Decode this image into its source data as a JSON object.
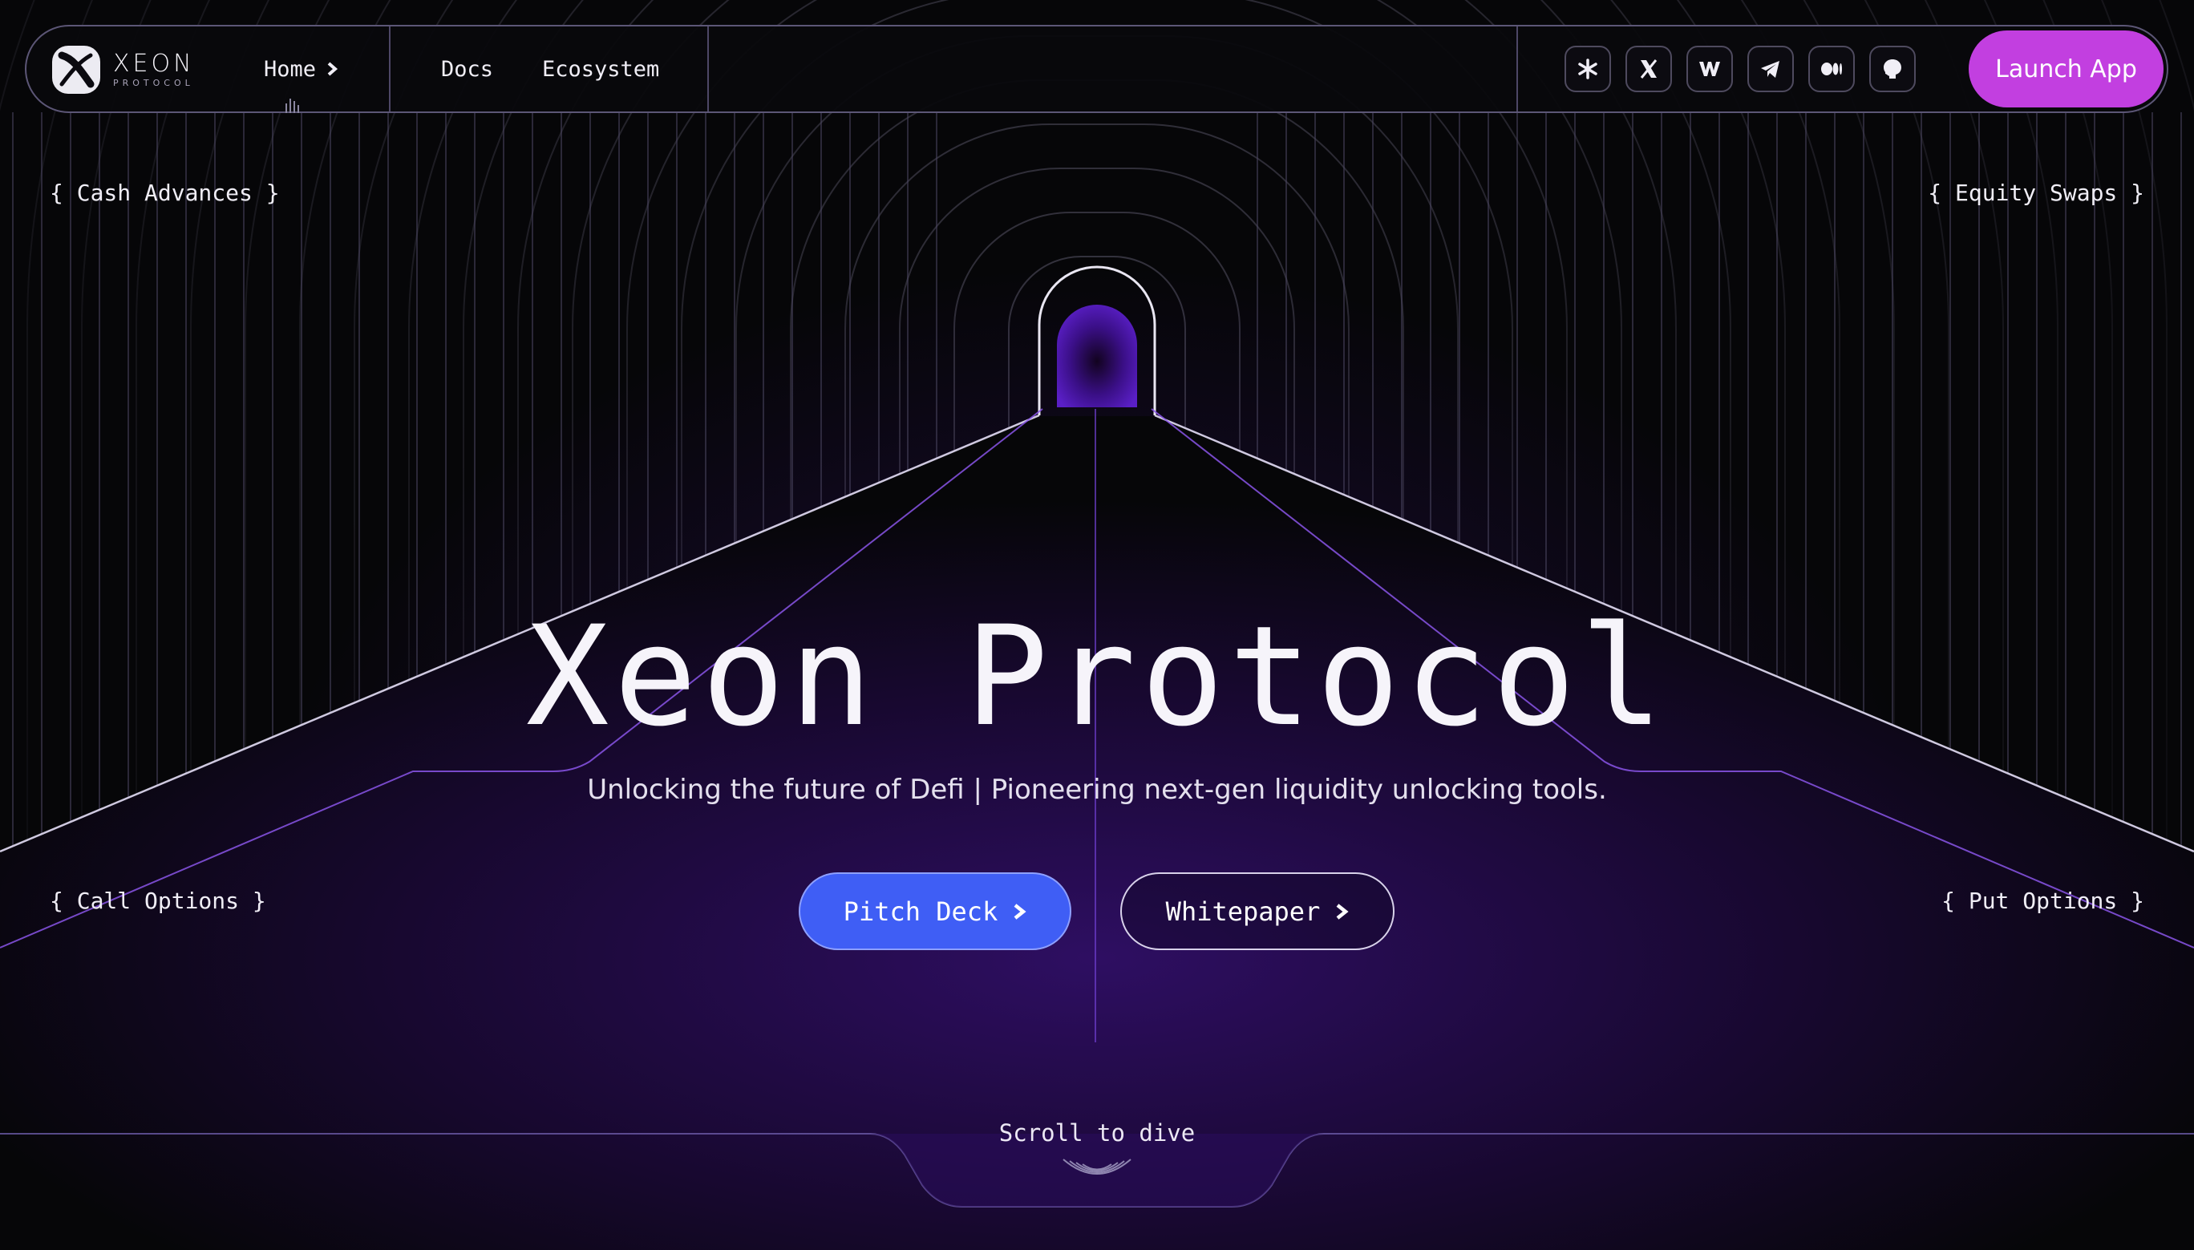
{
  "brand": {
    "name": "XEON",
    "sub": "PROTOCOL"
  },
  "nav": {
    "links": [
      {
        "label": "Home"
      },
      {
        "label": "Docs"
      },
      {
        "label": "Ecosystem"
      }
    ],
    "socials": [
      {
        "icon": "linktree-icon"
      },
      {
        "icon": "x-twitter-icon"
      },
      {
        "icon": "wellfound-icon"
      },
      {
        "icon": "telegram-icon"
      },
      {
        "icon": "medium-icon"
      },
      {
        "icon": "github-icon"
      }
    ],
    "launch_label": "Launch App"
  },
  "corners": {
    "top_left": "{ Cash Advances }",
    "top_right": "{ Equity Swaps }",
    "bottom_left": "{ Call Options }",
    "bottom_right": "{ Put Options }"
  },
  "hero": {
    "title": "Xeon Protocol",
    "subtitle": "Unlocking the future of Defi | Pioneering next-gen liquidity unlocking tools.",
    "primary_button": "Pitch Deck",
    "secondary_button": "Whitepaper"
  },
  "scroll": {
    "label": "Scroll to dive"
  },
  "colors": {
    "launch": "#c23fe0",
    "primary_button": "#3f5ef5",
    "glow": "#4e1a96"
  }
}
